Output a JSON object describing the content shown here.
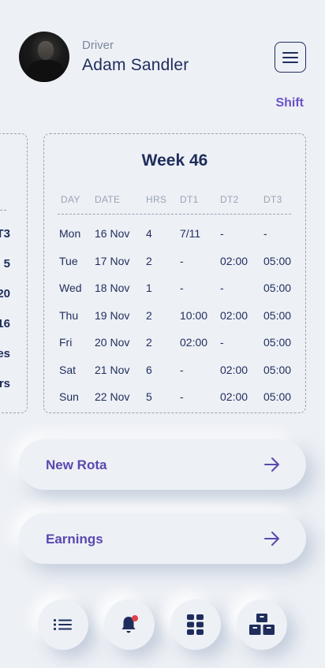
{
  "profile": {
    "role": "Driver",
    "name": "Adam Sandler"
  },
  "shift_link": "Shift",
  "partial_card": {
    "cells": [
      "T3",
      "5",
      "20",
      "16",
      "es",
      "rs"
    ]
  },
  "week": {
    "title": "Week 46",
    "headers": [
      "DAY",
      "DATE",
      "HRS",
      "DT1",
      "DT2",
      "DT3"
    ],
    "rows": [
      {
        "day": "Mon",
        "date": "16 Nov",
        "hrs": "4",
        "dt1": "7/11",
        "dt2": "-",
        "dt3": "-"
      },
      {
        "day": "Tue",
        "date": "17 Nov",
        "hrs": "2",
        "dt1": "-",
        "dt2": "02:00",
        "dt3": "05:00"
      },
      {
        "day": "Wed",
        "date": "18 Nov",
        "hrs": "1",
        "dt1": "-",
        "dt2": "-",
        "dt3": "05:00"
      },
      {
        "day": "Thu",
        "date": "19 Nov",
        "hrs": "2",
        "dt1": "10:00",
        "dt2": "02:00",
        "dt3": "05:00"
      },
      {
        "day": "Fri",
        "date": "20 Nov",
        "hrs": "2",
        "dt1": "02:00",
        "dt2": "-",
        "dt3": "05:00"
      },
      {
        "day": "Sat",
        "date": "21 Nov",
        "hrs": "6",
        "dt1": "-",
        "dt2": "02:00",
        "dt3": "05:00"
      },
      {
        "day": "Sun",
        "date": "22 Nov",
        "hrs": "5",
        "dt1": "-",
        "dt2": "02:00",
        "dt3": "05:00"
      }
    ]
  },
  "actions": {
    "new_rota": "New Rota",
    "earnings": "Earnings"
  },
  "nav": {
    "icons": [
      "list-icon",
      "bell-icon",
      "grid-icon",
      "boxes-icon"
    ]
  },
  "colors": {
    "background": "#edf0f5",
    "text_primary": "#1f2d5c",
    "accent": "#6a52c6",
    "muted": "#9aa3b6",
    "notification_dot": "#e0404a"
  }
}
